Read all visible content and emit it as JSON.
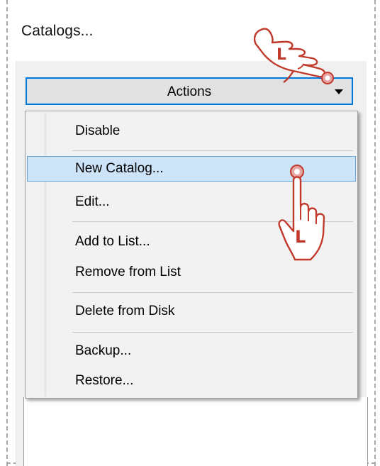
{
  "section": {
    "title": "Catalogs..."
  },
  "actions": {
    "label": "Actions",
    "chevron_icon": "chevron-down-icon"
  },
  "menu": {
    "items": [
      {
        "label": "Disable"
      },
      {
        "label": "New Catalog..."
      },
      {
        "label": "Edit..."
      },
      {
        "label": "Add to List..."
      },
      {
        "label": "Remove from List"
      },
      {
        "label": "Delete from Disk"
      },
      {
        "label": "Backup..."
      },
      {
        "label": "Restore..."
      }
    ]
  },
  "cursors": {
    "top": {
      "icon": "hand-pointer-icon",
      "letter": "L"
    },
    "menu": {
      "icon": "hand-pointer-icon",
      "letter": "L"
    }
  },
  "colors": {
    "accent": "#0078d7",
    "highlight": "#cde3f8",
    "cursor": "#c0392b"
  }
}
